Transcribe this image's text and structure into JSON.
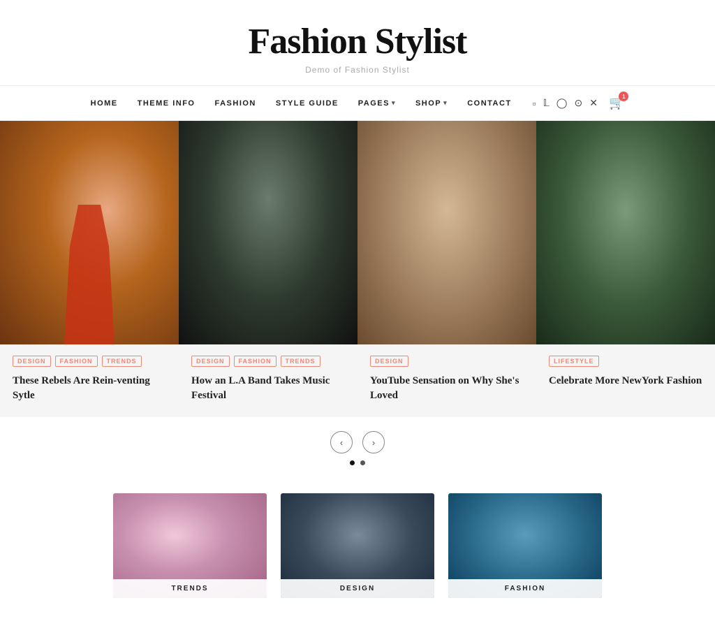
{
  "site": {
    "title": "Fashion Stylist",
    "tagline": "Demo of Fashion Stylist"
  },
  "nav": {
    "links": [
      {
        "label": "HOME",
        "id": "home",
        "hasDropdown": false
      },
      {
        "label": "THEME INFO",
        "id": "theme-info",
        "hasDropdown": false
      },
      {
        "label": "FASHION",
        "id": "fashion",
        "hasDropdown": false
      },
      {
        "label": "STYLE GUIDE",
        "id": "style-guide",
        "hasDropdown": false
      },
      {
        "label": "PAGES",
        "id": "pages",
        "hasDropdown": true
      },
      {
        "label": "SHOP",
        "id": "shop",
        "hasDropdown": true
      },
      {
        "label": "CONTACT",
        "id": "contact",
        "hasDropdown": false
      }
    ],
    "social": [
      {
        "id": "facebook",
        "icon": "f",
        "unicode": "🗔"
      },
      {
        "id": "twitter",
        "icon": "t",
        "unicode": "🐦"
      },
      {
        "id": "instagram",
        "icon": "i",
        "unicode": "📷"
      },
      {
        "id": "pinterest",
        "icon": "p",
        "unicode": "●"
      },
      {
        "id": "x",
        "icon": "x",
        "unicode": "✕"
      }
    ],
    "cart": {
      "icon": "🛒",
      "count": "1"
    }
  },
  "carousel": {
    "cards": [
      {
        "id": "card-1",
        "tags": [
          "DESIGN",
          "FASHION",
          "TRENDS"
        ],
        "title": "These Rebels Are Rein-venting Sytle",
        "imgClass": "img-1"
      },
      {
        "id": "card-2",
        "tags": [
          "DESIGN",
          "FASHION",
          "TRENDS"
        ],
        "title": "How an L.A Band Takes Music Festival",
        "imgClass": "img-2"
      },
      {
        "id": "card-3",
        "tags": [
          "DESIGN"
        ],
        "title": "YouTube Sensation on Why She's Loved",
        "imgClass": "img-3"
      },
      {
        "id": "card-4",
        "tags": [
          "LIFESTYLE"
        ],
        "title": "Celebrate More NewYork Fashion",
        "imgClass": "img-4"
      }
    ],
    "prev_label": "‹",
    "next_label": "›",
    "dots": [
      {
        "active": true
      },
      {
        "active": false
      }
    ]
  },
  "bottom_grid": {
    "items": [
      {
        "id": "grid-1",
        "label": "TRENDS",
        "imgClass": "gi-1"
      },
      {
        "id": "grid-2",
        "label": "DESIGN",
        "imgClass": "gi-2"
      },
      {
        "id": "grid-3",
        "label": "FASHION",
        "imgClass": "gi-3"
      }
    ]
  }
}
